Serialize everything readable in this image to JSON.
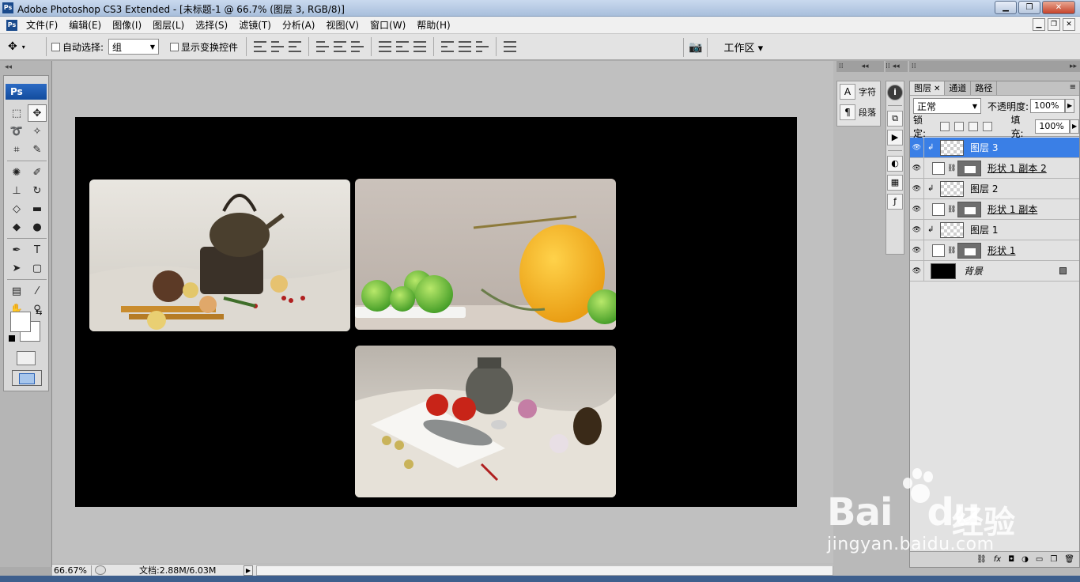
{
  "window": {
    "title": "Adobe Photoshop CS3 Extended - [未标题-1 @ 66.7% (图层 3, RGB/8)]",
    "app_icon": "Ps"
  },
  "menu": [
    "文件(F)",
    "编辑(E)",
    "图像(I)",
    "图层(L)",
    "选择(S)",
    "滤镜(T)",
    "分析(A)",
    "视图(V)",
    "窗口(W)",
    "帮助(H)"
  ],
  "options": {
    "auto_select_label": "自动选择:",
    "auto_select_value": "组",
    "show_transform_label": "显示变换控件",
    "workspace_label": "工作区"
  },
  "toolbox": {
    "badge": "Ps",
    "tools": [
      "marquee-icon",
      "move-icon",
      "lasso-icon",
      "magic-wand-icon",
      "crop-icon",
      "slice-icon",
      "healing-icon",
      "brush-icon",
      "stamp-icon",
      "history-brush-icon",
      "eraser-icon",
      "gradient-icon",
      "blur-icon",
      "dodge-icon",
      "pen-icon",
      "type-icon",
      "path-select-icon",
      "shape-icon",
      "notes-icon",
      "eyedropper-icon",
      "hand-icon",
      "zoom-icon"
    ],
    "type_glyph": "T"
  },
  "status": {
    "zoom": "66.67%",
    "doc_size": "文档:2.88M/6.03M"
  },
  "char_panel": {
    "char_label": "字符",
    "para_label": "段落"
  },
  "layers_panel": {
    "tabs": [
      "图层",
      "通道",
      "路径"
    ],
    "blend_mode": "正常",
    "opacity_label": "不透明度:",
    "opacity": "100%",
    "lock_label": "锁定:",
    "fill_label": "填充:",
    "fill": "100%",
    "layers": [
      {
        "name": "图层 3",
        "kind": "pixel",
        "clipped": true,
        "selected": true
      },
      {
        "name": "形状 1 副本 2",
        "kind": "shape",
        "clipped": false,
        "selected": false
      },
      {
        "name": "图层 2",
        "kind": "pixel",
        "clipped": true,
        "selected": false
      },
      {
        "name": "形状 1 副本",
        "kind": "shape",
        "clipped": false,
        "selected": false
      },
      {
        "name": "图层 1",
        "kind": "pixel",
        "clipped": true,
        "selected": false
      },
      {
        "name": "形状 1",
        "kind": "shape",
        "clipped": false,
        "selected": false
      },
      {
        "name": "背景",
        "kind": "background",
        "clipped": false,
        "selected": false
      }
    ]
  },
  "watermark": {
    "brand": "Bai",
    "brand_tail": "du",
    "cn": "经验",
    "url": "jingyan.baidu.com"
  },
  "colors": {
    "selection": "#3a7fe6",
    "canvas_bg": "#c0c0c0",
    "document": "#000000"
  }
}
